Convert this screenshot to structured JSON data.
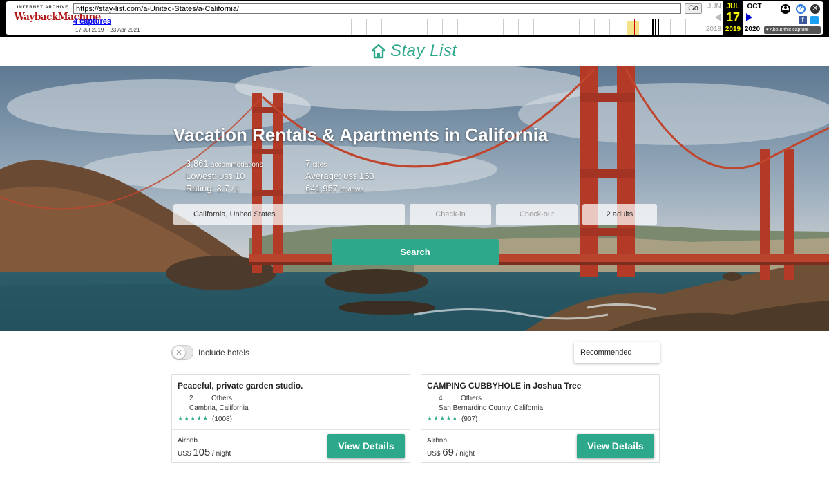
{
  "wayback": {
    "logo_top": "INTERNET ARCHIVE",
    "logo_main": "WaybackMachine",
    "url": "https://stay-list.com/a-United-States/a-California/",
    "go_label": "Go",
    "captures_label": "4 captures",
    "date_range": "17 Jul 2019 – 23 Apr 2021",
    "prev_month": "JUN",
    "current_month": "JUL",
    "next_month": "OCT",
    "current_day": "17",
    "prev_year": "2018",
    "current_year": "2019",
    "next_year": "2020",
    "about_label": "About this capture"
  },
  "site": {
    "logo_text": "Stay List",
    "brand_color": "#2da88a"
  },
  "hero": {
    "title": "Vacation Rentals & Apartments in California",
    "stats": {
      "accommodations_count": "3,861",
      "accommodations_label": "accommodations",
      "lowest_label": "Lowest:",
      "lowest_currency": "US$",
      "lowest_value": "10",
      "rating_label": "Rating:",
      "rating_value": "3.7",
      "rating_max": "/ 5",
      "sites_count": "7",
      "sites_label": "sites",
      "average_label": "Average:",
      "average_currency": "US$",
      "average_value": "163",
      "reviews_count": "641,957",
      "reviews_label": "reviews"
    },
    "search": {
      "location_value": "California, United States",
      "checkin_placeholder": "Check-in",
      "checkout_placeholder": "Check-out",
      "guests_value": "2 adults",
      "button_label": "Search"
    }
  },
  "filters": {
    "include_hotels_label": "Include hotels",
    "include_hotels_on": false,
    "sort_value": "Recommended"
  },
  "listings": [
    {
      "title": "Peaceful, private garden studio.",
      "guests": "2",
      "type": "Others",
      "location": "Cambria, California",
      "stars": "★★★★★",
      "reviews": "(1008)",
      "provider": "Airbnb",
      "currency": "US$",
      "price": "105",
      "per": "/ night",
      "button_label": "View Details"
    },
    {
      "title": "CAMPING CUBBYHOLE in Joshua Tree",
      "guests": "4",
      "type": "Others",
      "location": "San Bernardino County, California",
      "stars": "★★★★★",
      "reviews": "(907)",
      "provider": "Airbnb",
      "currency": "US$",
      "price": "69",
      "per": "/ night",
      "button_label": "View Details"
    }
  ]
}
